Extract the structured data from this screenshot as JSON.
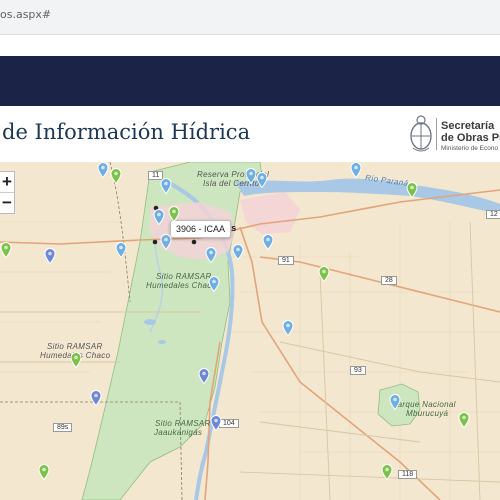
{
  "browser": {
    "url_fragment": "os.aspx#"
  },
  "header": {
    "site_title": "de Información Hídrica",
    "logo": {
      "line1": "Secretaría",
      "line2": "de Obras Públi",
      "line3": "Ministerio de Econo"
    }
  },
  "map": {
    "zoom_in": "+",
    "zoom_out": "−",
    "tooltip": "3906 - ICAA",
    "labels": {
      "reserva_1": "Reserva  Provincial",
      "reserva_2": "Isla  del  Cerrito",
      "sitio_ramsar_1_a": "Sitio  RAMSAR",
      "sitio_ramsar_1_b": "Humedales  Chaco",
      "sitio_ramsar_2_a": "Sitio  RAMSAR",
      "sitio_ramsar_2_b": "Humedales  Chaco",
      "sitio_ramsar_3_a": "Sitio  RAMSAR",
      "sitio_ramsar_3_b": "Jaaukanigás",
      "parque_1": "Parque  Nacional",
      "parque_2": "Mburucuyá",
      "rio_parana": "Río  Paraná",
      "city_fragment": "es",
      "road_11": "11",
      "road_91": "91",
      "road_28": "28",
      "road_93": "93",
      "road_104": "104",
      "road_89s": "89s",
      "road_118": "118",
      "road_12": "12"
    },
    "colors": {
      "water": "#a8c8e6",
      "park": "#cde6c0",
      "land": "#f3e7d0",
      "marker_blue": "#6faee3",
      "marker_green": "#7bc24a",
      "marker_violet": "#6e86d6",
      "navbar": "#1b2447"
    }
  }
}
